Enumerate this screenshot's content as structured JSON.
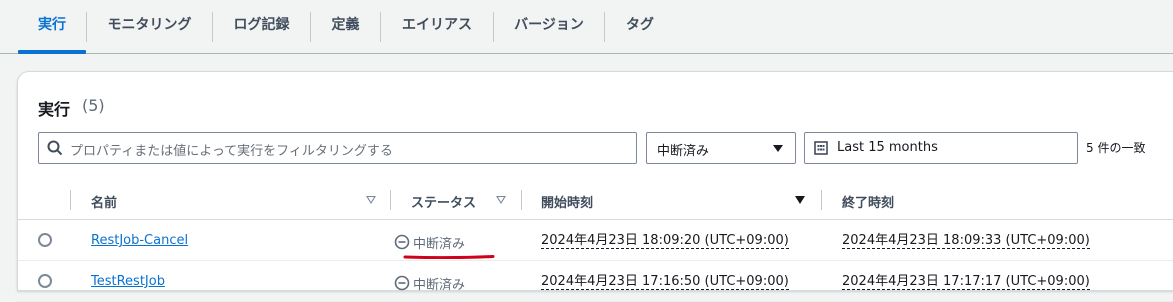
{
  "tabs": [
    {
      "label": "実行"
    },
    {
      "label": "モニタリング"
    },
    {
      "label": "ログ記録"
    },
    {
      "label": "定義"
    },
    {
      "label": "エイリアス"
    },
    {
      "label": "バージョン"
    },
    {
      "label": "タグ"
    }
  ],
  "panel": {
    "title": "実行",
    "count": "(5)",
    "search_placeholder": "プロパティまたは値によって実行をフィルタリングする",
    "status_filter": "中断済み",
    "date_range": "Last 15 months",
    "match_text": "5 件の一致"
  },
  "columns": {
    "name": "名前",
    "status": "ステータス",
    "start": "開始時刻",
    "end": "終了時刻"
  },
  "rows": [
    {
      "name": "RestJob-Cancel",
      "status": "中断済み",
      "start": "2024年4月23日 18:09:20 (UTC+09:00)",
      "end": "2024年4月23日 18:09:33 (UTC+09:00)"
    },
    {
      "name": "TestRestJob",
      "status": "中断済み",
      "start": "2024年4月23日 17:16:50 (UTC+09:00)",
      "end": "2024年4月23日 17:17:17 (UTC+09:00)"
    }
  ],
  "colors": {
    "accent": "#0972d3",
    "annotation": "#d0021b"
  },
  "icons": {
    "search": "search-icon",
    "calendar": "calendar-icon",
    "status": "stopped-icon",
    "sort": "caret-down-icon"
  }
}
